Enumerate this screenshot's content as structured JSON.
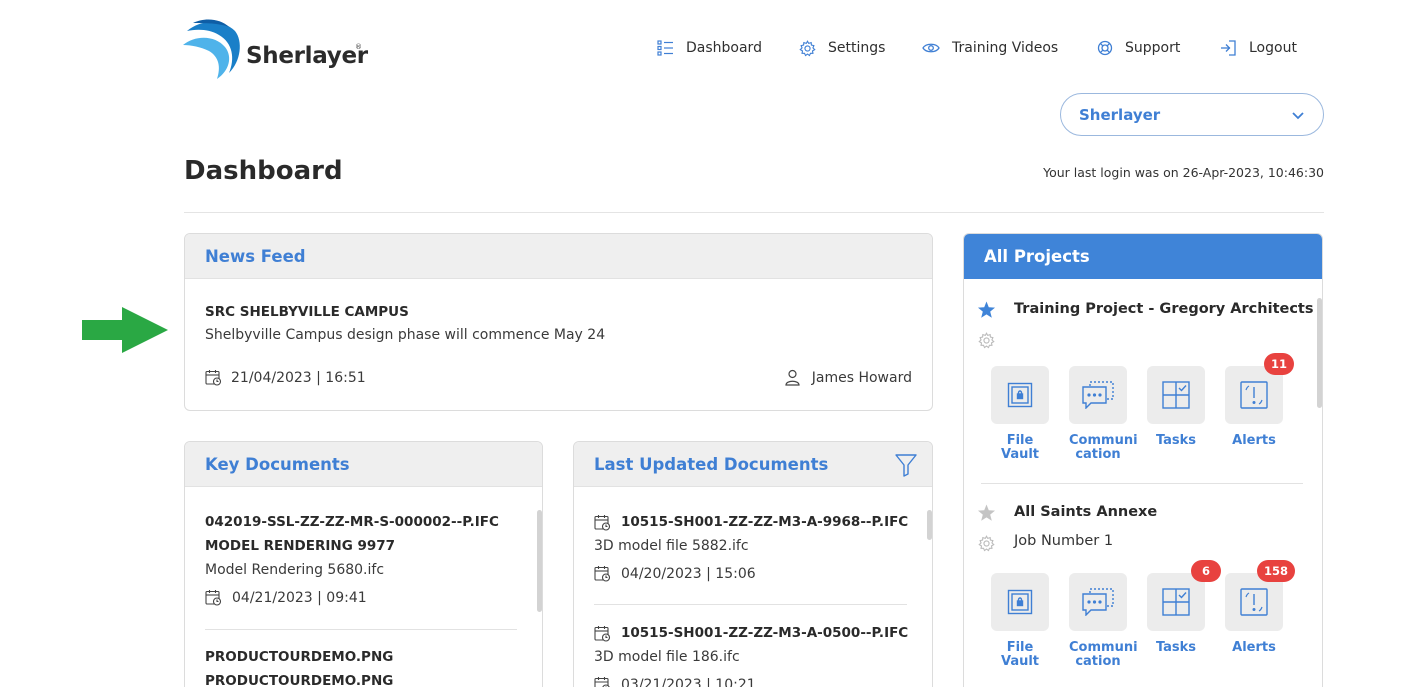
{
  "brand": {
    "name": "Sherlayer",
    "reg_mark": "®"
  },
  "nav": {
    "dashboard": "Dashboard",
    "settings": "Settings",
    "training_videos": "Training Videos",
    "support": "Support",
    "logout": "Logout"
  },
  "org_select": {
    "value": "Sherlayer"
  },
  "page": {
    "title": "Dashboard",
    "last_login": "Your last login was on 26-Apr-2023, 10:46:30"
  },
  "news_feed": {
    "title": "News Feed",
    "item": {
      "headline": "SRC SHELBYVILLE CAMPUS",
      "body": "Shelbyville Campus design phase will commence May 24",
      "date": "21/04/2023 | 16:51",
      "author": "James Howard"
    }
  },
  "key_documents": {
    "title": "Key Documents",
    "items": [
      {
        "name_line1": "042019-SSL-ZZ-ZZ-MR-S-000002--P.IFC",
        "name_line2": "MODEL RENDERING 9977",
        "subtitle": "Model Rendering 5680.ifc",
        "date": "04/21/2023 | 09:41"
      },
      {
        "name_line1": "PRODUCTOURDEMO.PNG",
        "name_line2": "PRODUCTOURDEMO.PNG"
      }
    ]
  },
  "last_updated": {
    "title": "Last Updated Documents",
    "items": [
      {
        "name": "10515-SH001-ZZ-ZZ-M3-A-9968--P.IFC",
        "subtitle": "3D model file 5882.ifc",
        "date": "04/20/2023 | 15:06"
      },
      {
        "name": "10515-SH001-ZZ-ZZ-M3-A-0500--P.IFC",
        "subtitle": "3D model file 186.ifc",
        "date": "03/21/2023 | 10:21"
      }
    ]
  },
  "all_projects": {
    "title": "All Projects",
    "projects": [
      {
        "name": "Training Project - Gregory Architects",
        "subtitle": "",
        "favorite": true,
        "tiles": [
          {
            "label1": "File Vault",
            "label2": "",
            "badge": ""
          },
          {
            "label1": "Communi",
            "label2": "cation",
            "badge": ""
          },
          {
            "label1": "Tasks",
            "label2": "",
            "badge": ""
          },
          {
            "label1": "Alerts",
            "label2": "",
            "badge": "11"
          }
        ]
      },
      {
        "name": "All Saints Annexe",
        "subtitle": "Job Number 1",
        "favorite": false,
        "tiles": [
          {
            "label1": "File Vault",
            "label2": "",
            "badge": ""
          },
          {
            "label1": "Communi",
            "label2": "cation",
            "badge": ""
          },
          {
            "label1": "Tasks",
            "label2": "",
            "badge": "6"
          },
          {
            "label1": "Alerts",
            "label2": "",
            "badge": "158"
          }
        ]
      }
    ]
  },
  "colors": {
    "accent": "#3f7fd4",
    "header_blue": "#3f84d8",
    "badge_red": "#e8423f",
    "arrow_green": "#2aa844"
  }
}
